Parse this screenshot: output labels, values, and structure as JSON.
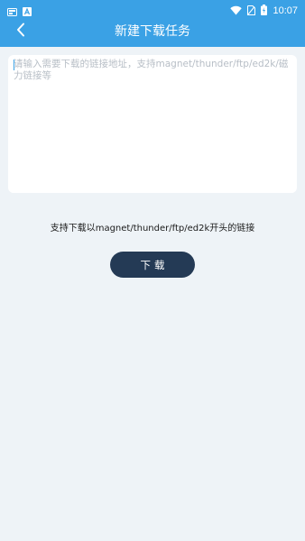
{
  "status_bar": {
    "left_icons": [
      "sim-card-icon",
      "text-a-icon"
    ],
    "right_icons": [
      "wifi-icon",
      "no-sim-icon",
      "battery-charging-icon"
    ],
    "time": "10:07"
  },
  "toolbar": {
    "back_icon": "chevron-left-icon",
    "title": "新建下载任务"
  },
  "link_input": {
    "placeholder": "请输入需要下载的链接地址，支持magnet/thunder/ftp/ed2k/磁力链接等",
    "value": ""
  },
  "hint": {
    "text": "支持下载以magnet/thunder/ftp/ed2k开头的链接"
  },
  "download_button": {
    "label": "下载"
  },
  "colors": {
    "header": "#3aa1e5",
    "background": "#eef3f7",
    "button": "#243a55",
    "placeholder": "#b7bec6"
  }
}
